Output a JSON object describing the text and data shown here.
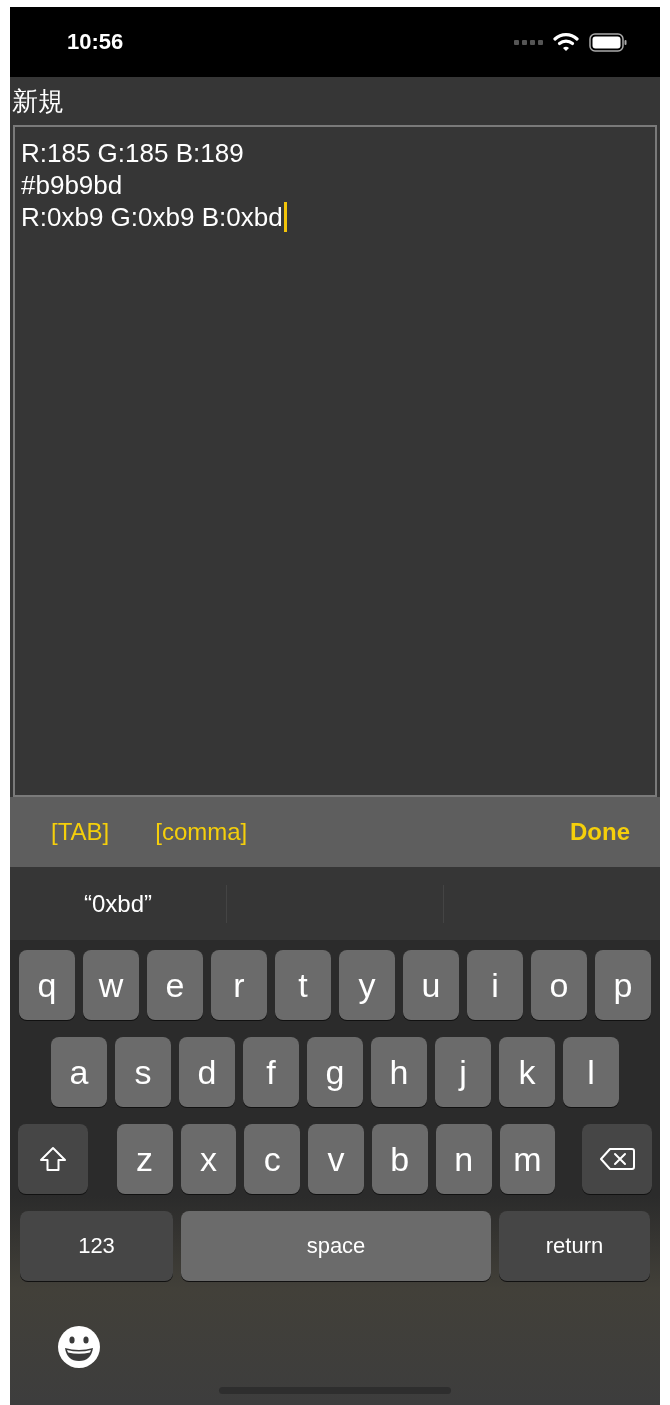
{
  "status_bar": {
    "time": "10:56"
  },
  "title": "新規",
  "editor": {
    "lines": [
      "R:185 G:185 B:189",
      "#b9b9bd",
      "R:0xb9 G:0xb9 B:0xbd"
    ],
    "focused": true
  },
  "toolbar": {
    "items": [
      "[TAB]",
      "[comma]"
    ],
    "done": "Done"
  },
  "suggestions": [
    "“0xbd”"
  ],
  "keyboard": {
    "rows": [
      [
        {
          "kind": "letter",
          "label": "q"
        },
        {
          "kind": "letter",
          "label": "w"
        },
        {
          "kind": "letter",
          "label": "e"
        },
        {
          "kind": "letter",
          "label": "r"
        },
        {
          "kind": "letter",
          "label": "t"
        },
        {
          "kind": "letter",
          "label": "y"
        },
        {
          "kind": "letter",
          "label": "u"
        },
        {
          "kind": "letter",
          "label": "i"
        },
        {
          "kind": "letter",
          "label": "o"
        },
        {
          "kind": "letter",
          "label": "p"
        }
      ],
      [
        {
          "kind": "letter",
          "label": "a"
        },
        {
          "kind": "letter",
          "label": "s"
        },
        {
          "kind": "letter",
          "label": "d"
        },
        {
          "kind": "letter",
          "label": "f"
        },
        {
          "kind": "letter",
          "label": "g"
        },
        {
          "kind": "letter",
          "label": "h"
        },
        {
          "kind": "letter",
          "label": "j"
        },
        {
          "kind": "letter",
          "label": "k"
        },
        {
          "kind": "letter",
          "label": "l"
        }
      ],
      [
        {
          "kind": "shift"
        },
        {
          "kind": "letter",
          "label": "z"
        },
        {
          "kind": "letter",
          "label": "x"
        },
        {
          "kind": "letter",
          "label": "c"
        },
        {
          "kind": "letter",
          "label": "v"
        },
        {
          "kind": "letter",
          "label": "b"
        },
        {
          "kind": "letter",
          "label": "n"
        },
        {
          "kind": "letter",
          "label": "m"
        },
        {
          "kind": "delete"
        }
      ]
    ],
    "bottom_row": {
      "numbers_key": "123",
      "space_key": "space",
      "return_key": "return"
    }
  }
}
